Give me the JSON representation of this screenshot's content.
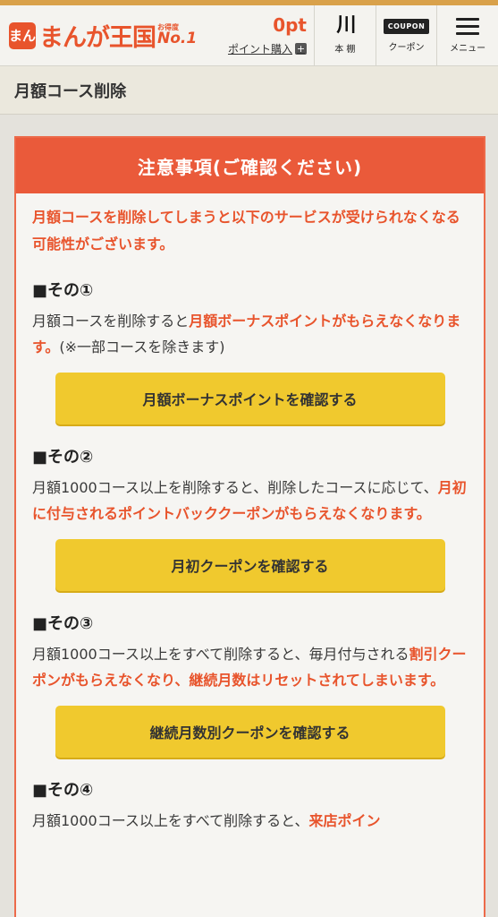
{
  "header": {
    "logo_mark": "まん",
    "logo_text": "まんが王国",
    "logo_badge_small": "お得度",
    "logo_badge_big": "No.1",
    "points_value": "0pt",
    "points_link": "ポイント購入",
    "points_plus": "+",
    "shelf_icon": "川",
    "shelf_label": "本 棚",
    "coupon_icon": "COUPON",
    "coupon_label": "クーポン",
    "menu_label": "メニュー"
  },
  "page_title": "月額コース削除",
  "notice": {
    "heading": "注意事項(ご確認ください)",
    "intro": "月額コースを削除してしまうと以下のサービスが受けられなくなる可能性がございます。",
    "sections": [
      {
        "title": "■その①",
        "desc_pre": "月額コースを削除すると",
        "desc_hl": "月額ボーナスポイントがもらえなくなります。",
        "desc_post": "(※一部コースを除きます)",
        "button": "月額ボーナスポイントを確認する"
      },
      {
        "title": "■その②",
        "desc_pre": "月額1000コース以上を削除すると、削除したコースに応じて、",
        "desc_hl": "月初に付与されるポイントバッククーポンがもらえなくなります。",
        "desc_post": "",
        "button": "月初クーポンを確認する"
      },
      {
        "title": "■その③",
        "desc_pre": "月額1000コース以上をすべて削除すると、毎月付与される",
        "desc_hl": "割引クーポンがもらえなくなり、継続月数はリセットされてしまいます。",
        "desc_post": "",
        "button": "継続月数別クーポンを確認する"
      },
      {
        "title": "■その④",
        "desc_pre": "月額1000コース以上をすべて削除すると、",
        "desc_hl": "来店ポイン",
        "desc_post": ""
      }
    ]
  },
  "colors": {
    "accent": "#e8542c",
    "notice_header": "#ea5a3a",
    "button": "#f0c92e",
    "top_stripe": "#d9a14a"
  }
}
